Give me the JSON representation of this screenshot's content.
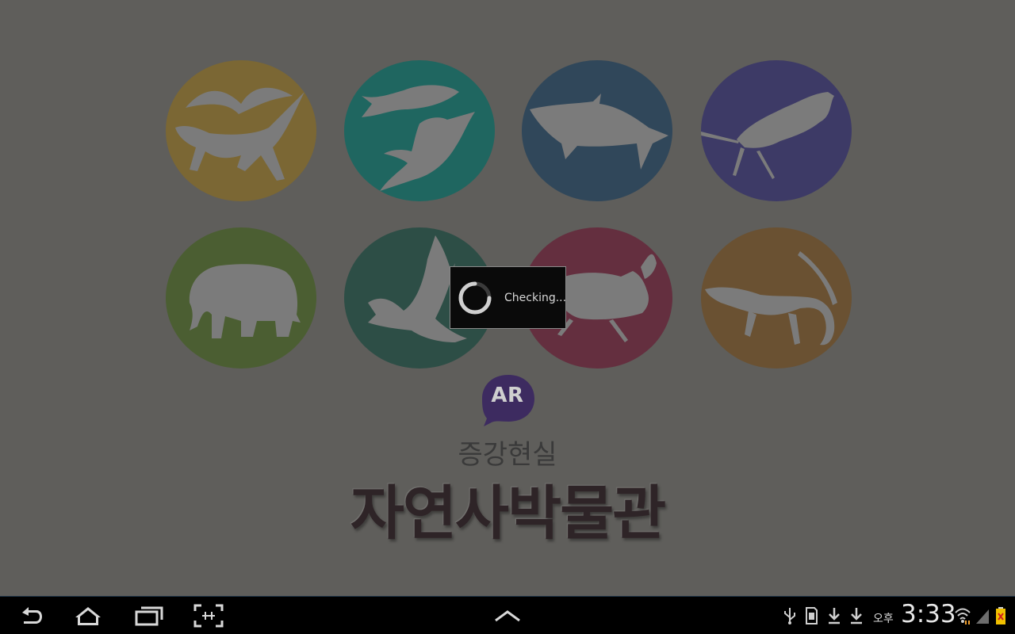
{
  "app": {
    "logo_badge": "AR",
    "subtitle": "증강현실",
    "title": "자연사박물관",
    "categories": [
      {
        "name": "dinosaurs",
        "color": "#7b6734"
      },
      {
        "name": "fish",
        "color": "#1f6660"
      },
      {
        "name": "sharks",
        "color": "#30475a"
      },
      {
        "name": "amphibians",
        "color": "#3d3a66"
      },
      {
        "name": "mammals",
        "color": "#4b5e32"
      },
      {
        "name": "birds",
        "color": "#2d4e46"
      },
      {
        "name": "insects",
        "color": "#642f3f"
      },
      {
        "name": "reptiles",
        "color": "#6a5132"
      }
    ]
  },
  "dialog": {
    "message": "Checking..."
  },
  "system_bar": {
    "ampm": "오후",
    "time": "3:33",
    "nav_buttons": [
      "back-icon",
      "home-icon",
      "recent-apps-icon",
      "screenshot-icon"
    ],
    "center_button": "chevron-up-icon",
    "status_icons": [
      "usb-icon",
      "sd-card-icon",
      "download-icon",
      "download-icon",
      "wifi-icon",
      "signal-icon",
      "battery-icon"
    ]
  }
}
